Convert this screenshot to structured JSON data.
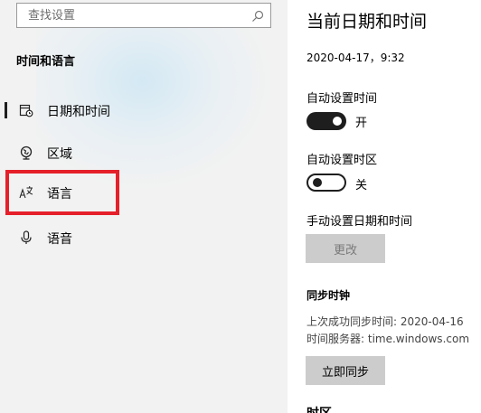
{
  "search": {
    "placeholder": "查找设置"
  },
  "sidebar": {
    "section_title": "时间和语言",
    "items": [
      {
        "label": "日期和时间",
        "icon": "calendar-clock-icon",
        "selected": true
      },
      {
        "label": "区域",
        "icon": "globe-region-icon"
      },
      {
        "label": "语言",
        "icon": "language-icon"
      },
      {
        "label": "语音",
        "icon": "microphone-icon"
      }
    ],
    "highlight_color": "#e5202a"
  },
  "main": {
    "title": "当前日期和时间",
    "current_datetime": "2020-04-17，9:32",
    "auto_time": {
      "label": "自动设置时间",
      "state": "开",
      "on": true
    },
    "auto_timezone": {
      "label": "自动设置时区",
      "state": "关",
      "on": false
    },
    "manual": {
      "label": "手动设置日期和时间",
      "button": "更改"
    },
    "sync": {
      "title": "同步时钟",
      "last_sync": "上次成功同步时间: 2020-04-16",
      "server": "时间服务器: time.windows.com",
      "button": "立即同步"
    },
    "next_heading": "时区"
  }
}
